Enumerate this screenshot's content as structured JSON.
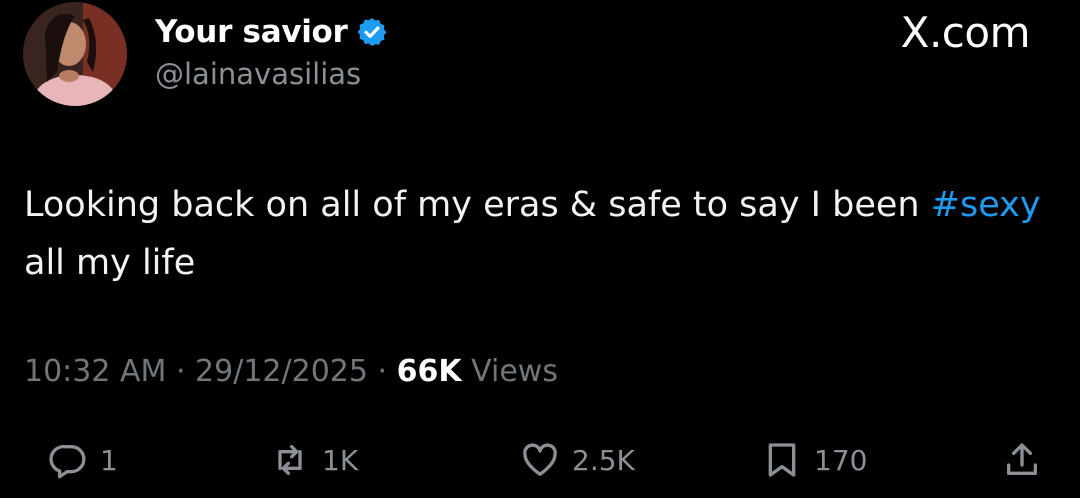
{
  "tweet": {
    "author": {
      "display_name": "Your savior",
      "handle": "@lainavasilias",
      "verified": true
    },
    "brand": "X.com",
    "text_part1": "Looking back on all of my eras & safe to say I been ",
    "hashtag": "#sexy",
    "text_part2": " all my life",
    "time": "10:32 AM",
    "separator": "·",
    "date": "29/12/2025",
    "views_count": "66K",
    "views_label": "Views"
  },
  "actions": {
    "reply": {
      "icon": "reply-icon",
      "count": "1"
    },
    "repost": {
      "icon": "repost-icon",
      "count": "1K"
    },
    "like": {
      "icon": "heart-icon",
      "count": "2.5K"
    },
    "bookmark": {
      "icon": "bookmark-icon",
      "count": "170"
    },
    "share": {
      "icon": "share-icon"
    }
  },
  "colors": {
    "background": "#000000",
    "hashtag": "#1d9bf0",
    "verified_badge": "#1d9bf0",
    "secondary_text": "#71767b"
  }
}
